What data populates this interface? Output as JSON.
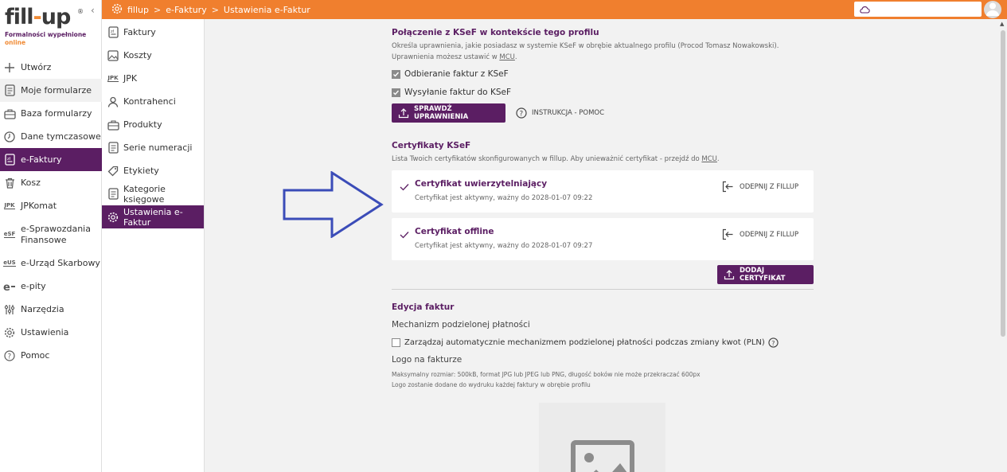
{
  "brand": {
    "logo": "fill-up",
    "registered": "®",
    "tagline_1": "Formalności wypełnione",
    "tagline_2": "online",
    "accent": "#5b1e63",
    "orange": "#f07f2e"
  },
  "sidebar": {
    "collapse_icon": "chevron-left-icon",
    "items": [
      {
        "label": "Utwórz",
        "icon": "plus-icon"
      },
      {
        "label": "Moje formularze",
        "icon": "document-icon"
      },
      {
        "label": "Baza formularzy",
        "icon": "briefcase-icon"
      },
      {
        "label": "Dane tymczasowe",
        "icon": "clock-icon"
      },
      {
        "label": "e-Faktury",
        "icon": "invoice-icon"
      },
      {
        "label": "Kosz",
        "icon": "trash-icon"
      },
      {
        "label": "JPKomat",
        "icon": "jpk-icon",
        "text": "JPK"
      },
      {
        "label": "e-Sprawozdania Finansowe",
        "icon": "esf-icon",
        "text": "eSF"
      },
      {
        "label": "e-Urząd Skarbowy",
        "icon": "eus-icon",
        "text": "eUS"
      },
      {
        "label": "e-pity",
        "icon": "epity-icon"
      },
      {
        "label": "Narzędzia",
        "icon": "tools-icon"
      },
      {
        "label": "Ustawienia",
        "icon": "gear-icon"
      },
      {
        "label": "Pomoc",
        "icon": "help-icon"
      }
    ]
  },
  "topbar": {
    "crumb_1": "fillup",
    "crumb_2": "e-Faktury",
    "crumb_3": "Ustawienia e-Faktur",
    "sep": ">",
    "search_icon": "cloud-icon",
    "avatar_icon": "user-icon"
  },
  "subnav": {
    "items": [
      {
        "label": "Faktury",
        "icon": "invoice-icon"
      },
      {
        "label": "Koszty",
        "icon": "image-icon"
      },
      {
        "label": "JPK",
        "icon": "jpk-icon",
        "text": "JPK"
      },
      {
        "label": "Kontrahenci",
        "icon": "person-icon"
      },
      {
        "label": "Produkty",
        "icon": "briefcase-icon"
      },
      {
        "label": "Serie numeracji",
        "icon": "document-icon"
      },
      {
        "label": "Etykiety",
        "icon": "tag-icon"
      },
      {
        "label": "Kategorie księgowe",
        "icon": "document-icon"
      },
      {
        "label": "Ustawienia e-Faktur",
        "icon": "gear-icon"
      }
    ]
  },
  "ksef": {
    "title": "Połączenie z KSeF w kontekście tego profilu",
    "desc_1": "Określa uprawnienia, jakie posiadasz w systemie KSeF w obrębie aktualnego profilu (Procod Tomasz Nowakowski).",
    "desc_2a": "Uprawnienia możesz ustawić w ",
    "desc_2_link": "MCU",
    "desc_2b": ".",
    "perm_receive": "Odbieranie faktur z KSeF",
    "perm_send": "Wysyłanie faktur do KSeF",
    "check_button": "SPRAWDŹ UPRAWNIENIA",
    "help_link": "INSTRUKCJA - POMOC"
  },
  "certs": {
    "title": "Certyfikaty KSeF",
    "desc_a": "Lista Twoich certyfikatów skonfigurowanych w fillup. Aby unieważnić certyfikat - przejdź do ",
    "desc_link": "MCU",
    "desc_b": ".",
    "items": [
      {
        "name": "Certyfikat uwierzytelniający",
        "status": "Certyfikat jest aktywny, ważny do 2028-01-07 09:22",
        "action": "ODEPNIJ Z FILLUP"
      },
      {
        "name": "Certyfikat offline",
        "status": "Certyfikat jest aktywny, ważny do 2028-01-07 09:27",
        "action": "ODEPNIJ Z FILLUP"
      }
    ],
    "add_button": "DODAJ CERTYFIKAT"
  },
  "edit": {
    "title": "Edycja faktur",
    "split_label": "Mechanizm podzielonej płatności",
    "split_check": "Zarządzaj automatycznie mechanizmem podzielonej płatności podczas zmiany kwot (PLN)",
    "logo_label": "Logo na fakturze",
    "logo_desc_1": "Maksymalny rozmiar: 500kB, format JPG lub JPEG lub PNG, długość boków nie może przekraczać 600px",
    "logo_desc_2": "Logo zostanie dodane do wydruku każdej faktury w obrębie profilu",
    "logo_placeholder_icon": "image-placeholder-icon"
  },
  "annotation": {
    "arrow_icon": "arrow-right-icon",
    "arrow_color": "#3b4cb8"
  }
}
